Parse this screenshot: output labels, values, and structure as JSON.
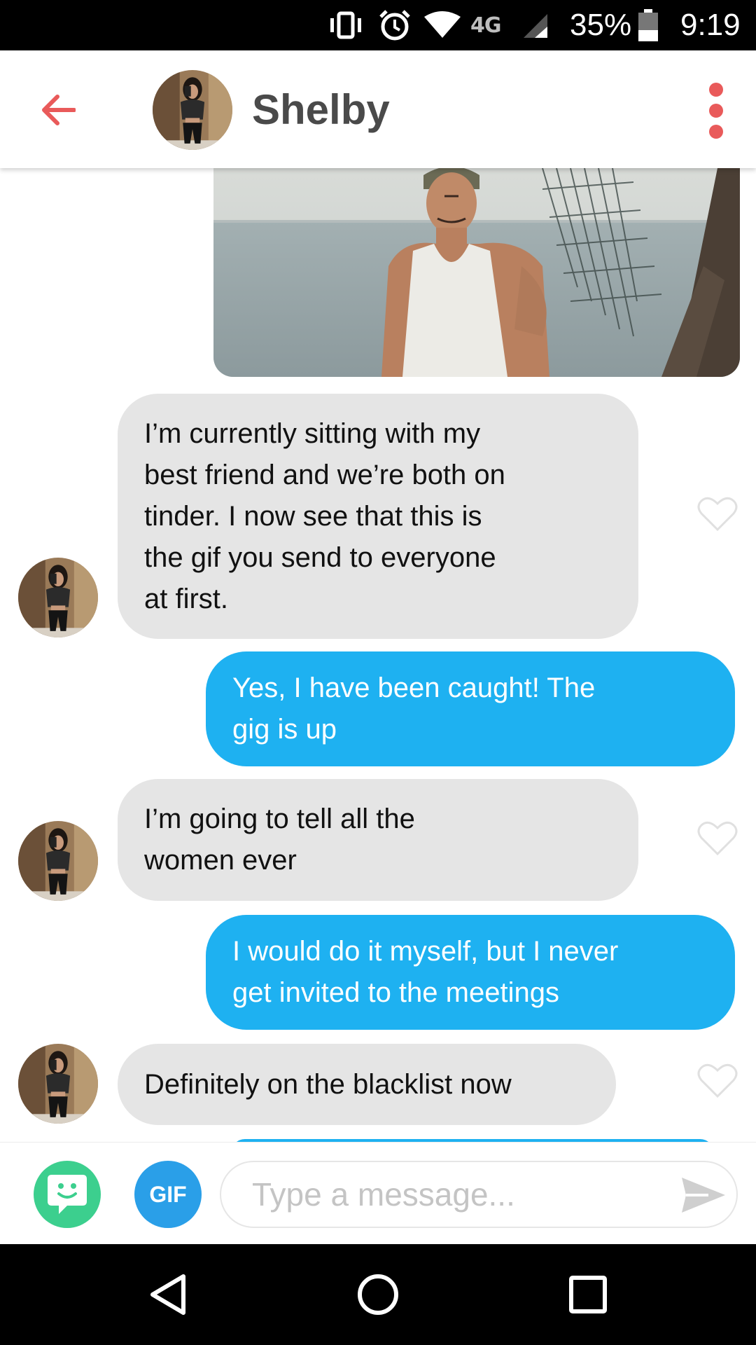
{
  "status_bar": {
    "network": "4G",
    "battery_percent": "35%",
    "time": "9:19",
    "icons": [
      "vibrate-icon",
      "alarm-icon",
      "wifi-icon",
      "signal-icon",
      "battery-icon"
    ]
  },
  "header": {
    "contact_name": "Shelby",
    "icons": [
      "back-arrow-icon",
      "more-vertical-icon"
    ]
  },
  "messages": [
    {
      "sender": "me",
      "type": "gif"
    },
    {
      "sender": "them",
      "type": "text",
      "lines": [
        "I’m currently sitting with my",
        "best friend and we’re both on",
        "tinder. I now see that this is",
        "the gif you send to everyone",
        "at first."
      ]
    },
    {
      "sender": "me",
      "type": "text",
      "lines": [
        "Yes, I have been caught! The",
        "gig is up"
      ]
    },
    {
      "sender": "them",
      "type": "text",
      "lines": [
        "I’m going to tell all the",
        "women ever"
      ]
    },
    {
      "sender": "me",
      "type": "text",
      "lines": [
        "I would do it myself, but I never",
        "get invited to the meetings"
      ]
    },
    {
      "sender": "them",
      "type": "text",
      "lines": [
        "Definitely on the blacklist now"
      ]
    }
  ],
  "composer": {
    "gif_label": "GIF",
    "placeholder": "Type a message...",
    "icons": [
      "bitmoji-icon",
      "send-icon"
    ]
  },
  "nav_bar": {
    "icons": [
      "back-triangle-icon",
      "home-circle-icon",
      "recents-square-icon"
    ]
  },
  "colors": {
    "accent": "#e95a5a",
    "outgoing_bubble": "#1eb1f1",
    "incoming_bubble": "#e5e5e5",
    "bitmoji": "#3ccf8e",
    "gif_button": "#2a9fe8"
  }
}
